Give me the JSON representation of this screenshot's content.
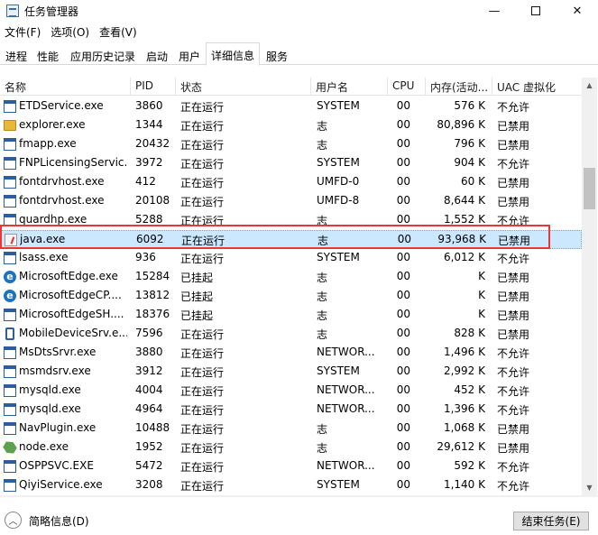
{
  "window": {
    "title": "任务管理器",
    "minimize_glyph": "—",
    "close_glyph": "✕"
  },
  "menu": [
    "文件(F)",
    "选项(O)",
    "查看(V)"
  ],
  "tabs": [
    {
      "label": "进程",
      "active": false
    },
    {
      "label": "性能",
      "active": false
    },
    {
      "label": "应用历史记录",
      "active": false
    },
    {
      "label": "启动",
      "active": false
    },
    {
      "label": "用户",
      "active": false
    },
    {
      "label": "详细信息",
      "active": true
    },
    {
      "label": "服务",
      "active": false
    }
  ],
  "columns": {
    "name": "名称",
    "pid": "PID",
    "status": "状态",
    "user": "用户名",
    "cpu": "CPU",
    "memory": "内存(活动...",
    "uac": "UAC 虚拟化"
  },
  "rows": [
    {
      "icon": "app-window-icon",
      "name": "ETDService.exe",
      "pid": "3860",
      "status": "正在运行",
      "user": "SYSTEM",
      "cpu": "00",
      "memory": "576 K",
      "uac": "不允许"
    },
    {
      "icon": "folder-icon",
      "name": "explorer.exe",
      "pid": "1344",
      "status": "正在运行",
      "user": "志",
      "cpu": "00",
      "memory": "80,896 K",
      "uac": "已禁用"
    },
    {
      "icon": "app-window-icon",
      "name": "fmapp.exe",
      "pid": "20432",
      "status": "正在运行",
      "user": "志",
      "cpu": "00",
      "memory": "796 K",
      "uac": "已禁用"
    },
    {
      "icon": "app-window-icon",
      "name": "FNPLicensingServic...",
      "pid": "3972",
      "status": "正在运行",
      "user": "SYSTEM",
      "cpu": "00",
      "memory": "904 K",
      "uac": "不允许"
    },
    {
      "icon": "app-window-icon",
      "name": "fontdrvhost.exe",
      "pid": "412",
      "status": "正在运行",
      "user": "UMFD-0",
      "cpu": "00",
      "memory": "60 K",
      "uac": "已禁用"
    },
    {
      "icon": "app-window-icon",
      "name": "fontdrvhost.exe",
      "pid": "20108",
      "status": "正在运行",
      "user": "UMFD-8",
      "cpu": "00",
      "memory": "8,644 K",
      "uac": "已禁用"
    },
    {
      "icon": "app-window-icon",
      "name": "quardhp.exe",
      "pid": "5288",
      "status": "正在运行",
      "user": "志",
      "cpu": "00",
      "memory": "1,552 K",
      "uac": "不允许"
    },
    {
      "icon": "java-icon",
      "name": "java.exe",
      "pid": "6092",
      "status": "正在运行",
      "user": "志",
      "cpu": "00",
      "memory": "93,968 K",
      "uac": "已禁用",
      "selected": true
    },
    {
      "icon": "app-window-icon",
      "name": "lsass.exe",
      "pid": "936",
      "status": "正在运行",
      "user": "SYSTEM",
      "cpu": "00",
      "memory": "6,012 K",
      "uac": "不允许"
    },
    {
      "icon": "edge-icon",
      "name": "MicrosoftEdge.exe",
      "pid": "15284",
      "status": "已挂起",
      "user": "志",
      "cpu": "00",
      "memory": "K",
      "uac": "已禁用"
    },
    {
      "icon": "edge-icon",
      "name": "MicrosoftEdgeCP....",
      "pid": "13812",
      "status": "已挂起",
      "user": "志",
      "cpu": "00",
      "memory": "K",
      "uac": "已禁用"
    },
    {
      "icon": "app-window-icon",
      "name": "MicrosoftEdgeSH....",
      "pid": "18376",
      "status": "已挂起",
      "user": "志",
      "cpu": "00",
      "memory": "K",
      "uac": "已禁用"
    },
    {
      "icon": "device-icon",
      "name": "MobileDeviceSrv.e...",
      "pid": "7596",
      "status": "正在运行",
      "user": "志",
      "cpu": "00",
      "memory": "828 K",
      "uac": "已禁用"
    },
    {
      "icon": "app-window-icon",
      "name": "MsDtsSrvr.exe",
      "pid": "3880",
      "status": "正在运行",
      "user": "NETWOR...",
      "cpu": "00",
      "memory": "1,496 K",
      "uac": "不允许"
    },
    {
      "icon": "app-window-icon",
      "name": "msmdsrv.exe",
      "pid": "3912",
      "status": "正在运行",
      "user": "SYSTEM",
      "cpu": "00",
      "memory": "2,992 K",
      "uac": "不允许"
    },
    {
      "icon": "app-window-icon",
      "name": "mysqld.exe",
      "pid": "4004",
      "status": "正在运行",
      "user": "NETWOR...",
      "cpu": "00",
      "memory": "452 K",
      "uac": "不允许"
    },
    {
      "icon": "app-window-icon",
      "name": "mysqld.exe",
      "pid": "4964",
      "status": "正在运行",
      "user": "NETWOR...",
      "cpu": "00",
      "memory": "1,396 K",
      "uac": "不允许"
    },
    {
      "icon": "app-window-icon",
      "name": "NavPlugin.exe",
      "pid": "10488",
      "status": "正在运行",
      "user": "志",
      "cpu": "00",
      "memory": "1,068 K",
      "uac": "已禁用"
    },
    {
      "icon": "node-icon",
      "name": "node.exe",
      "pid": "1952",
      "status": "正在运行",
      "user": "志",
      "cpu": "00",
      "memory": "29,612 K",
      "uac": "已禁用"
    },
    {
      "icon": "app-window-icon",
      "name": "OSPPSVC.EXE",
      "pid": "5472",
      "status": "正在运行",
      "user": "NETWOR...",
      "cpu": "00",
      "memory": "592 K",
      "uac": "不允许"
    },
    {
      "icon": "app-window-icon",
      "name": "QiyiService.exe",
      "pid": "3208",
      "status": "正在运行",
      "user": "SYSTEM",
      "cpu": "00",
      "memory": "1,140 K",
      "uac": "不允许"
    }
  ],
  "footer": {
    "collapse_glyph": "︿",
    "brief_info": "简略信息(D)",
    "end_task": "结束任务(E)"
  },
  "scrollbar": {
    "up_glyph": "▲",
    "down_glyph": "▼"
  }
}
